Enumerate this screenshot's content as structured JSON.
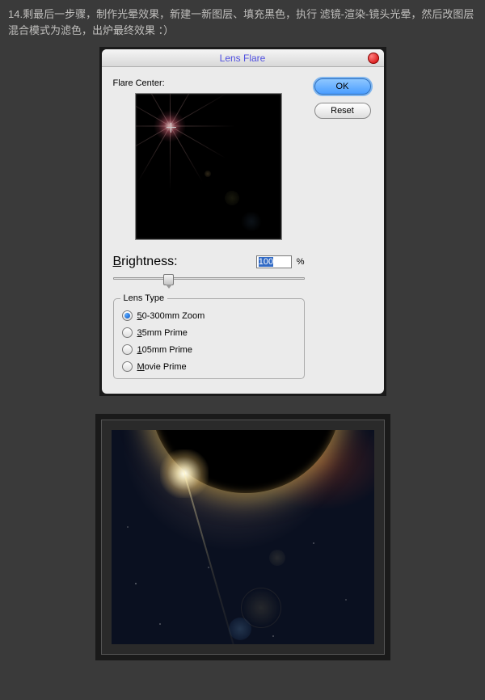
{
  "instruction": "14.剩最后一步骤，制作光晕效果，新建一新图层、填充黑色，执行 滤镜-渲染-镜头光晕，然后改图层混合模式为滤色，出炉最终效果 ：）",
  "dialog": {
    "title": "Lens Flare",
    "flare_center_label": "Flare Center:",
    "brightness_label": "Brightness:",
    "brightness_value": "100",
    "brightness_unit": "%",
    "lens_type_legend": "Lens Type",
    "lens_options": [
      {
        "label_pre": "",
        "label_u": "5",
        "label_post": "0-300mm Zoom",
        "checked": true
      },
      {
        "label_pre": "",
        "label_u": "3",
        "label_post": "5mm Prime",
        "checked": false
      },
      {
        "label_pre": "",
        "label_u": "1",
        "label_post": "05mm Prime",
        "checked": false
      },
      {
        "label_pre": "",
        "label_u": "M",
        "label_post": "ovie Prime",
        "checked": false
      }
    ],
    "ok_label": "OK",
    "reset_label": "Reset"
  }
}
